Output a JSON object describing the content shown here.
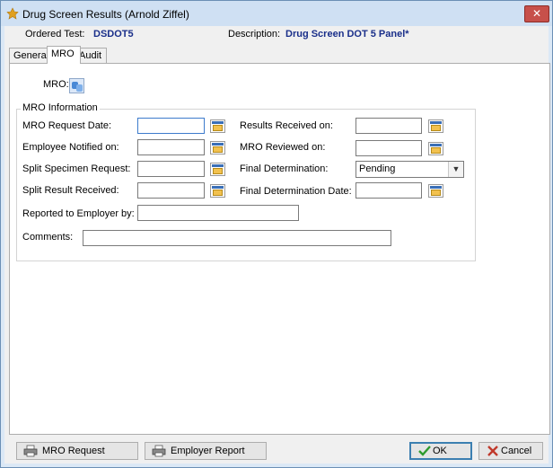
{
  "window": {
    "title": "Drug Screen Results (Arnold Ziffel)",
    "close_glyph": "✕"
  },
  "header": {
    "ordered_test_label": "Ordered Test:",
    "ordered_test_value": "DSDOT5",
    "description_label": "Description:",
    "description_value": "Drug Screen DOT 5 Panel*"
  },
  "tabs": [
    "General",
    "MRO",
    "Audit"
  ],
  "active_tab": "MRO",
  "mro": {
    "label": "MRO:",
    "icon": "contacts-icon"
  },
  "group": {
    "title": "MRO Information",
    "left_fields": [
      {
        "label": "MRO Request Date:",
        "value": ""
      },
      {
        "label": "Employee Notified on:",
        "value": ""
      },
      {
        "label": "Split Specimen Request:",
        "value": ""
      },
      {
        "label": "Split Result Received:",
        "value": ""
      }
    ],
    "right_fields": [
      {
        "label": "Results Received on:",
        "value": ""
      },
      {
        "label": "MRO Reviewed on:",
        "value": ""
      },
      {
        "label": "Final Determination:",
        "value": "Pending"
      },
      {
        "label": "Final Determination Date:",
        "value": ""
      }
    ],
    "reported_to_label": "Reported to Employer by:",
    "reported_to_value": "",
    "comments_label": "Comments:",
    "comments_value": ""
  },
  "buttons": {
    "mro_request": "MRO Request",
    "employer_report": "Employer Report",
    "ok": "OK",
    "cancel": "Cancel"
  },
  "colors": {
    "accent_blue": "#1a2f8a",
    "ok_check": "#2e9b2e",
    "cancel_x": "#c0392b"
  }
}
